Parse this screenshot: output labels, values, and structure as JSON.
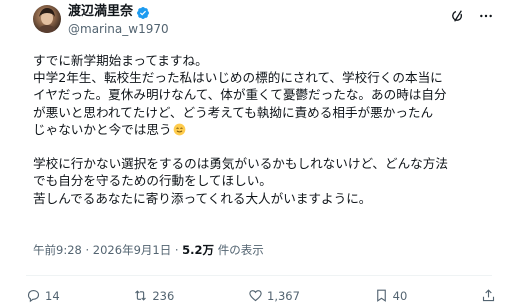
{
  "author": {
    "display_name": "渡辺満里奈",
    "handle": "@marina_w1970",
    "verified": true
  },
  "post": {
    "lines": [
      "すでに新学期始まってますね。",
      "中学2年生、転校生だった私はいじめの標的にされて、学校行くの本当に",
      "イヤだった。夏休み明けなんて、体が重くて憂鬱だったな。あの時は自分",
      "が悪いと思われてたけど、どう考えても執拗に責める相手が悪かったん",
      "じゃないかと今では思う"
    ],
    "emoji": "smiling-face-emoji",
    "lines2": [
      "学校に行かない選択をするのは勇気がいるかもしれないけど、どんな方法",
      "でも自分を守るための行動をしてほしい。",
      "苦しんでるあなたに寄り添ってくれる大人がいますように。"
    ]
  },
  "meta": {
    "time": "午前9:28",
    "date": "2026年9月1日",
    "views_count": "5.2万",
    "views_label": "件の表示",
    "separator": "·"
  },
  "actions": {
    "replies": "14",
    "reposts": "236",
    "likes": "1,367",
    "bookmarks": "40"
  },
  "icons": {
    "top": [
      "grok-icon",
      "more-icon"
    ],
    "bottom": [
      "reply-icon",
      "repost-icon",
      "like-icon",
      "bookmark-icon",
      "share-icon"
    ]
  },
  "colors": {
    "text": "#0f1419",
    "secondary": "#536471",
    "verified": "#1d9bf0",
    "divider": "#eff3f4"
  }
}
